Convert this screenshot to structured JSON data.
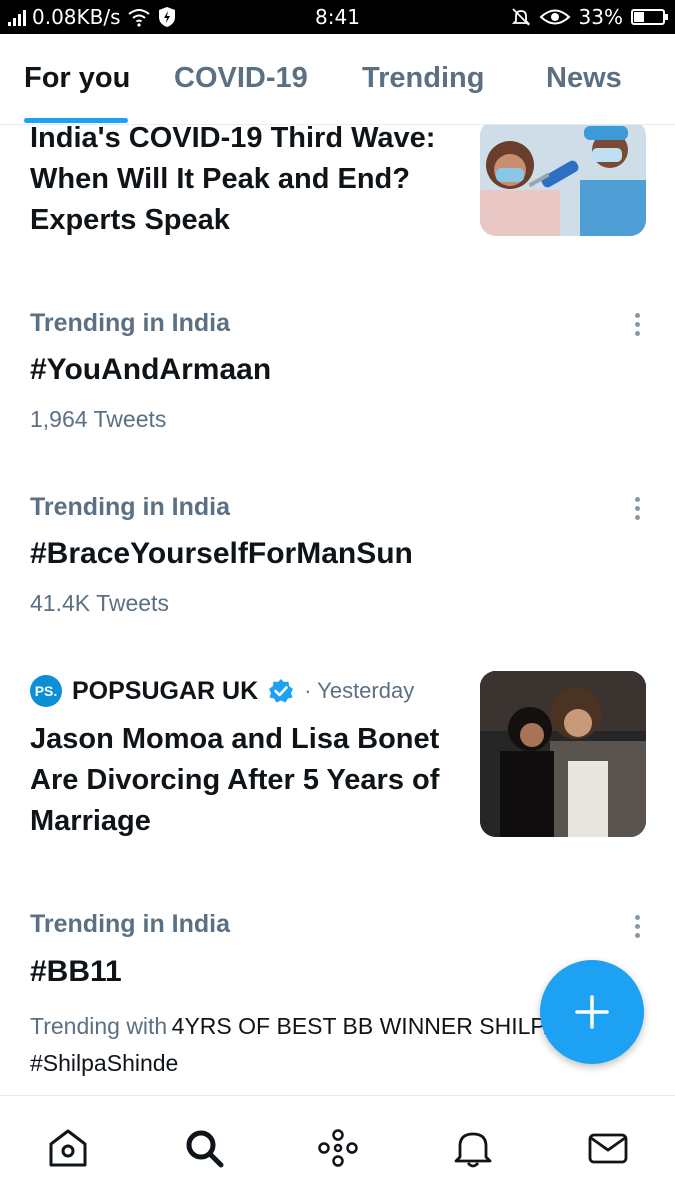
{
  "status_bar": {
    "network_speed": "0.08KB/s",
    "time": "8:41",
    "battery_percent": "33%",
    "battery_level": 0.33,
    "icons": [
      "signal-icon",
      "wifi-icon",
      "shield-icon",
      "mute-icon",
      "eye-icon",
      "battery-icon"
    ]
  },
  "tabs": [
    {
      "label": "For you",
      "active": true
    },
    {
      "label": "COVID-19",
      "active": false
    },
    {
      "label": "Trending",
      "active": false
    },
    {
      "label": "News",
      "active": false
    }
  ],
  "feed": {
    "story1": {
      "headline": "India's COVID-19 Third Wave: When Will It Peak and End? Experts Speak",
      "image": "vaccination-photo"
    },
    "trend1": {
      "context": "Trending in India",
      "tag": "#YouAndArmaan",
      "count": "1,964 Tweets"
    },
    "trend2": {
      "context": "Trending in India",
      "tag": "#BraceYourselfForManSun",
      "count": "41.4K Tweets"
    },
    "story2": {
      "source_logo": "PS.",
      "source": "POPSUGAR UK",
      "verified": true,
      "time": "· Yesterday",
      "headline": "Jason Momoa and Lisa Bonet Are Divorcing After 5 Years of Marriage",
      "image": "couple-photo"
    },
    "trend3": {
      "context": "Trending in India",
      "tag": "#BB11",
      "trending_with_label": "Trending with",
      "trending_with": "4YRS OF BEST BB WINNER SHILPA",
      "hashtag": "#ShilpaShinde"
    }
  },
  "fab": {
    "icon": "plus-icon"
  },
  "bottom_nav": [
    "home-icon",
    "search-icon",
    "spaces-icon",
    "bell-icon",
    "mail-icon"
  ],
  "colors": {
    "accent": "#1da1f2",
    "text": "#0f1419",
    "muted": "#5b7083"
  }
}
